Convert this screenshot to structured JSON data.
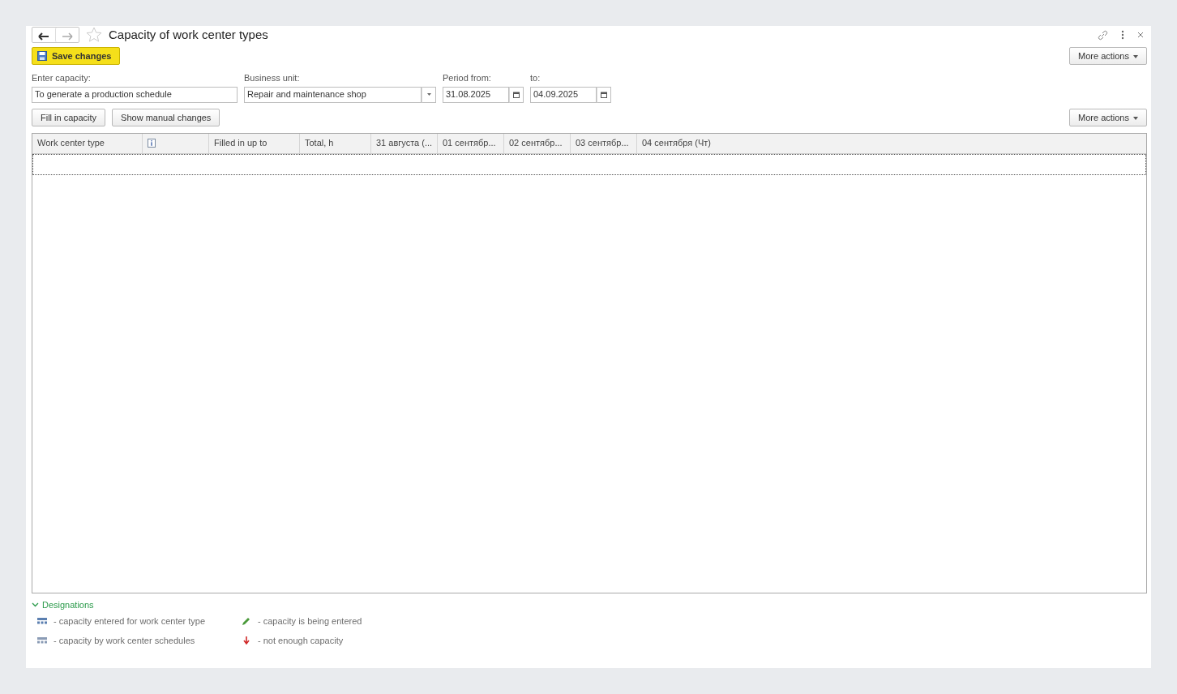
{
  "window": {
    "title": "Capacity of work center types",
    "favorite": false
  },
  "toolbar": {
    "save_button": "Save changes",
    "more_actions": "More actions"
  },
  "fields": [
    {
      "label": "Enter capacity:",
      "value": "To generate a production schedule",
      "kind": "text"
    },
    {
      "label": "Business unit:",
      "value": "Repair and maintenance shop",
      "kind": "select"
    },
    {
      "label": "Period from:",
      "value": "31.08.2025",
      "kind": "date"
    },
    {
      "label": "to:",
      "value": "04.09.2025",
      "kind": "date"
    }
  ],
  "table_toolbar": {
    "buttons": [
      "Fill in capacity",
      "Show manual changes"
    ],
    "more_actions": "More actions"
  },
  "table": {
    "columns": [
      {
        "kind": "text",
        "label": "Work center type"
      },
      {
        "kind": "icon"
      },
      {
        "kind": "text",
        "label": "Filled in up to"
      },
      {
        "kind": "text",
        "label": "Total, h"
      },
      {
        "kind": "text",
        "label": "31 августа (..."
      },
      {
        "kind": "text",
        "label": "01 сентябр..."
      },
      {
        "kind": "text",
        "label": "02 сентябр..."
      },
      {
        "kind": "text",
        "label": "03 сентябр..."
      },
      {
        "kind": "text",
        "label": "04 сентября (Чт)"
      }
    ]
  },
  "designations": {
    "title": "Designations",
    "expanded": true,
    "items": [
      {
        "kind": "grid",
        "text": "- capacity entered for work center type",
        "color": "#5b7fb0"
      },
      {
        "kind": "pencil",
        "text": "- capacity is being entered",
        "color": "#4a9a3a"
      },
      {
        "kind": "grid",
        "text": "- capacity by work center schedules",
        "color": "#8a9bb5"
      },
      {
        "kind": "arrow",
        "text": "- not enough capacity",
        "color": "#d02828"
      }
    ]
  }
}
